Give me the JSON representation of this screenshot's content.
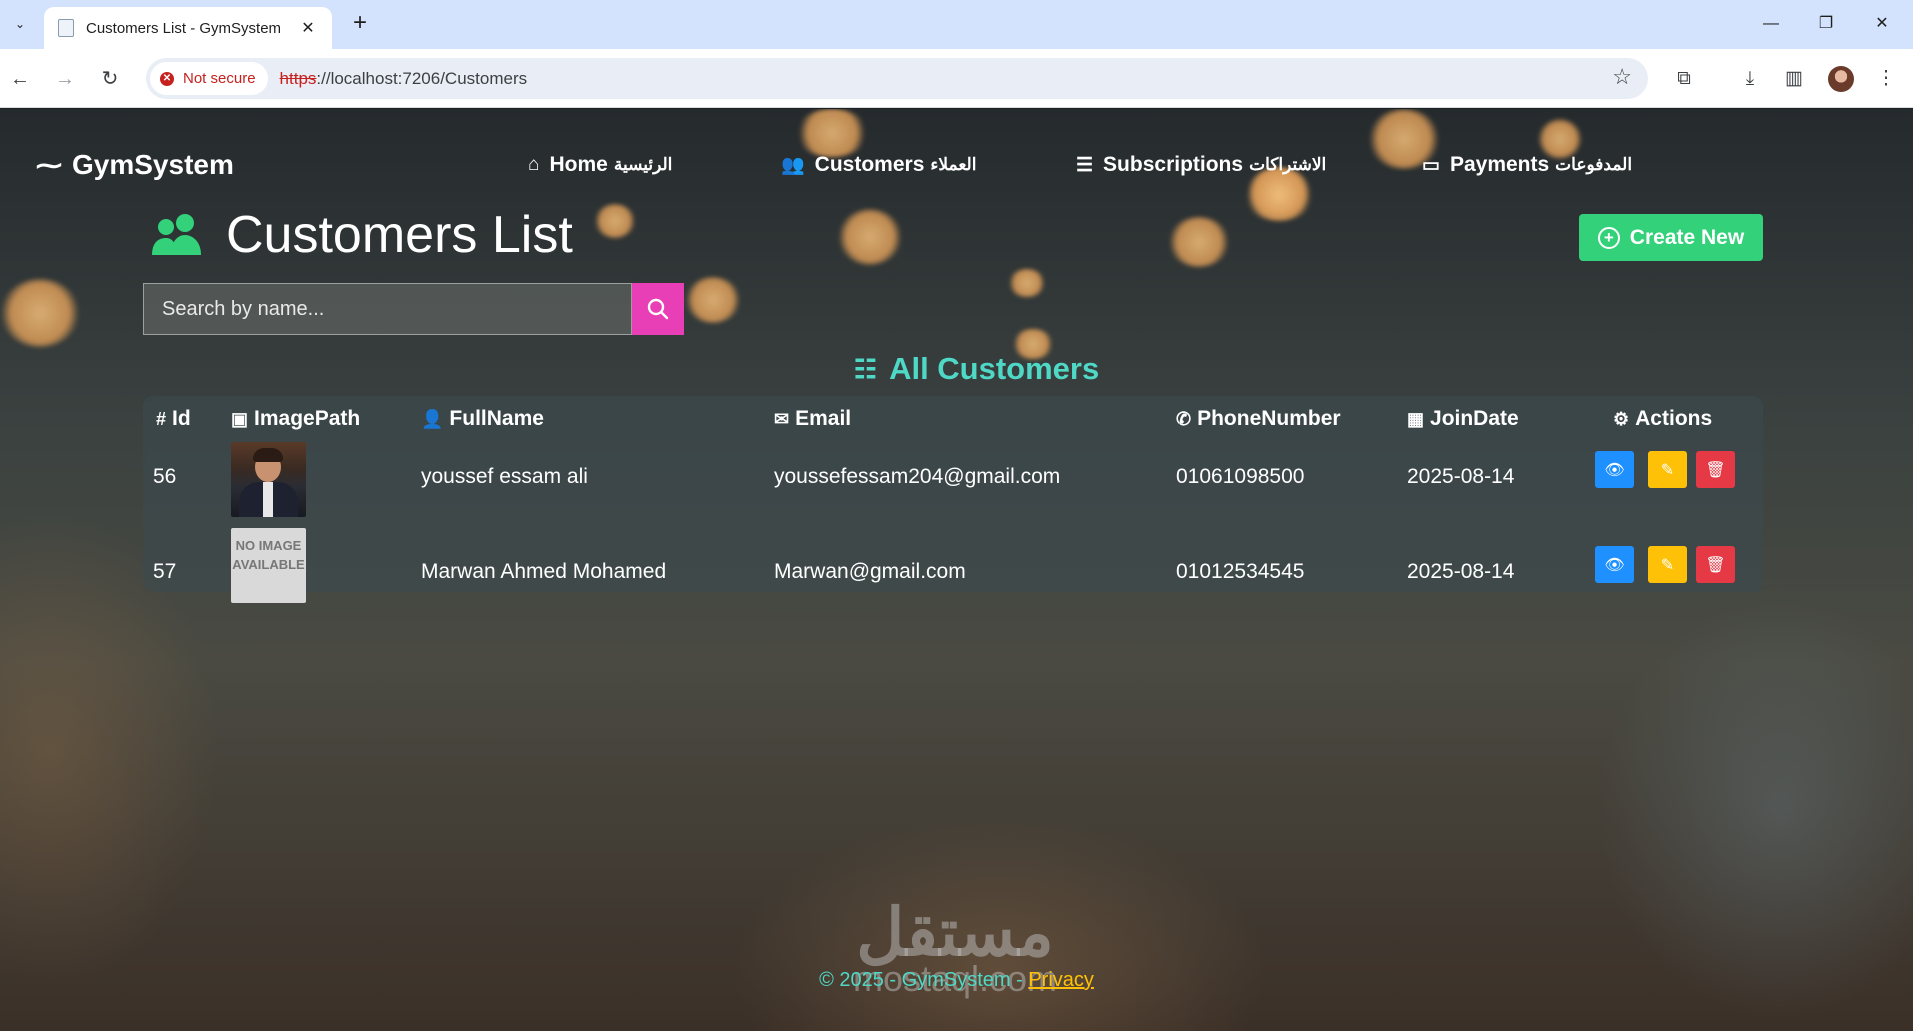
{
  "browser": {
    "tab_title": "Customers List - GymSystem",
    "tab_close": "✕",
    "new_tab": "+",
    "security_label": "Not secure",
    "url_scheme": "https",
    "url_rest": "://localhost:7206/Customers"
  },
  "navbar": {
    "brand": "GymSystem",
    "links": [
      {
        "label": "Home",
        "label_ar": "الرئيسية",
        "icon": "home-icon"
      },
      {
        "label": "Customers",
        "label_ar": "العملاء",
        "icon": "users-icon"
      },
      {
        "label": "Subscriptions",
        "label_ar": "الاشتراكات",
        "icon": "list-icon"
      },
      {
        "label": "Payments",
        "label_ar": "المدفوعات",
        "icon": "money-icon"
      }
    ]
  },
  "header": {
    "title": "Customers List",
    "create_label": "Create New"
  },
  "search": {
    "placeholder": "Search by name..."
  },
  "table": {
    "section_title": "All Customers",
    "columns": [
      {
        "label": "Id",
        "icon": "hash-icon"
      },
      {
        "label": "ImagePath",
        "icon": "image-icon"
      },
      {
        "label": "FullName",
        "icon": "person-icon"
      },
      {
        "label": "Email",
        "icon": "envelope-icon"
      },
      {
        "label": "PhoneNumber",
        "icon": "phone-icon"
      },
      {
        "label": "JoinDate",
        "icon": "calendar-icon"
      },
      {
        "label": "Actions",
        "icon": "gear-icon"
      }
    ],
    "rows": [
      {
        "id": "56",
        "image": "photo",
        "full_name": "youssef essam ali",
        "email": "youssefessam204@gmail.com",
        "phone": "01061098500",
        "join_date": "2025-08-14"
      },
      {
        "id": "57",
        "image": "NO IMAGE AVAILABLE",
        "full_name": "Marwan Ahmed Mohamed",
        "email": "Marwan@gmail.com",
        "phone": "01012534545",
        "join_date": "2025-08-14"
      }
    ]
  },
  "footer": {
    "text": "© 2025 - GymSystem - ",
    "privacy_label": "Privacy"
  },
  "watermark": {
    "arabic": "مستقل",
    "latin": "mostaql.com"
  },
  "colors": {
    "accent_teal": "#4fd8c6",
    "create_green": "#33d17a",
    "search_pink": "#e83fb6",
    "view_blue": "#1e90ff",
    "edit_yellow": "#ffc107",
    "delete_red": "#e53945"
  }
}
